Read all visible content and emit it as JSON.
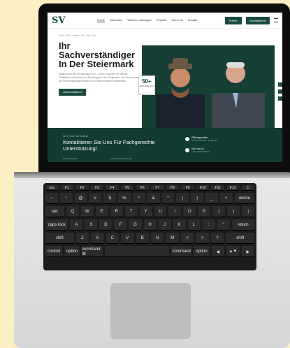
{
  "site": {
    "logo": "SV",
    "menu": [
      "Home",
      "Gutachten",
      "Weitere Leistungen",
      "Projekte",
      "Über uns",
      "Kontakt"
    ],
    "btn_primary": "Termin",
    "btn_secondary": "Kontaktieren",
    "kicker": "Seit 1982 immer für Sie Da!",
    "headline": "Ihr Sachverständiger In Der Steiermark",
    "description": "Willkommen bei SV Bauhaider KG – Ihrem Experten für präzise Gutachten und technische Beratungen in der Steiermark, seit Jahrzehnten auf Sachverständigenwissen und Fachkompetenz spezialisiert.",
    "cta": "Jetzt kontaktieren",
    "badge_value": "50+",
    "badge_label": "Jahre Erfahrung",
    "band_kicker": "Wir Freuen Wir Aufbau!",
    "band_title": "Kontaktieren Sie Uns Für Fachgerechte Unterstützung!",
    "band_sub_left": "Gutachterarbeit",
    "band_sub_right": "SUV Hell-mit Beratung",
    "info1_title": "Öffnungszeiten",
    "info1_text": "Mo-Fr: 8:00 Uhr - 16:00 Uhr",
    "info2_title": "Ruf Uns An",
    "info2_text": "+43 (0) 316 000 00"
  },
  "keyboard": {
    "fn_row": [
      "esc",
      "F1",
      "F2",
      "F3",
      "F4",
      "F5",
      "F6",
      "F7",
      "F8",
      "F9",
      "F10",
      "F11",
      "F12",
      "⏻"
    ],
    "row1": [
      "~",
      "!",
      "@",
      "#",
      "$",
      "%",
      "^",
      "&",
      "*",
      "(",
      ")",
      "_",
      "+",
      "delete"
    ],
    "row2": [
      "tab",
      "Q",
      "W",
      "E",
      "R",
      "T",
      "Y",
      "U",
      "I",
      "O",
      "P",
      "{",
      "}",
      "|"
    ],
    "row3": [
      "caps lock",
      "A",
      "S",
      "D",
      "F",
      "G",
      "H",
      "J",
      "K",
      "L",
      ":",
      "\"",
      "return"
    ],
    "row4": [
      "shift",
      "Z",
      "X",
      "C",
      "V",
      "B",
      "N",
      "M",
      "<",
      ">",
      "?",
      "shift"
    ],
    "row5": [
      "control",
      "option",
      "command ⌘",
      "",
      "command",
      "option",
      "◀",
      "▲▼",
      "▶"
    ]
  }
}
